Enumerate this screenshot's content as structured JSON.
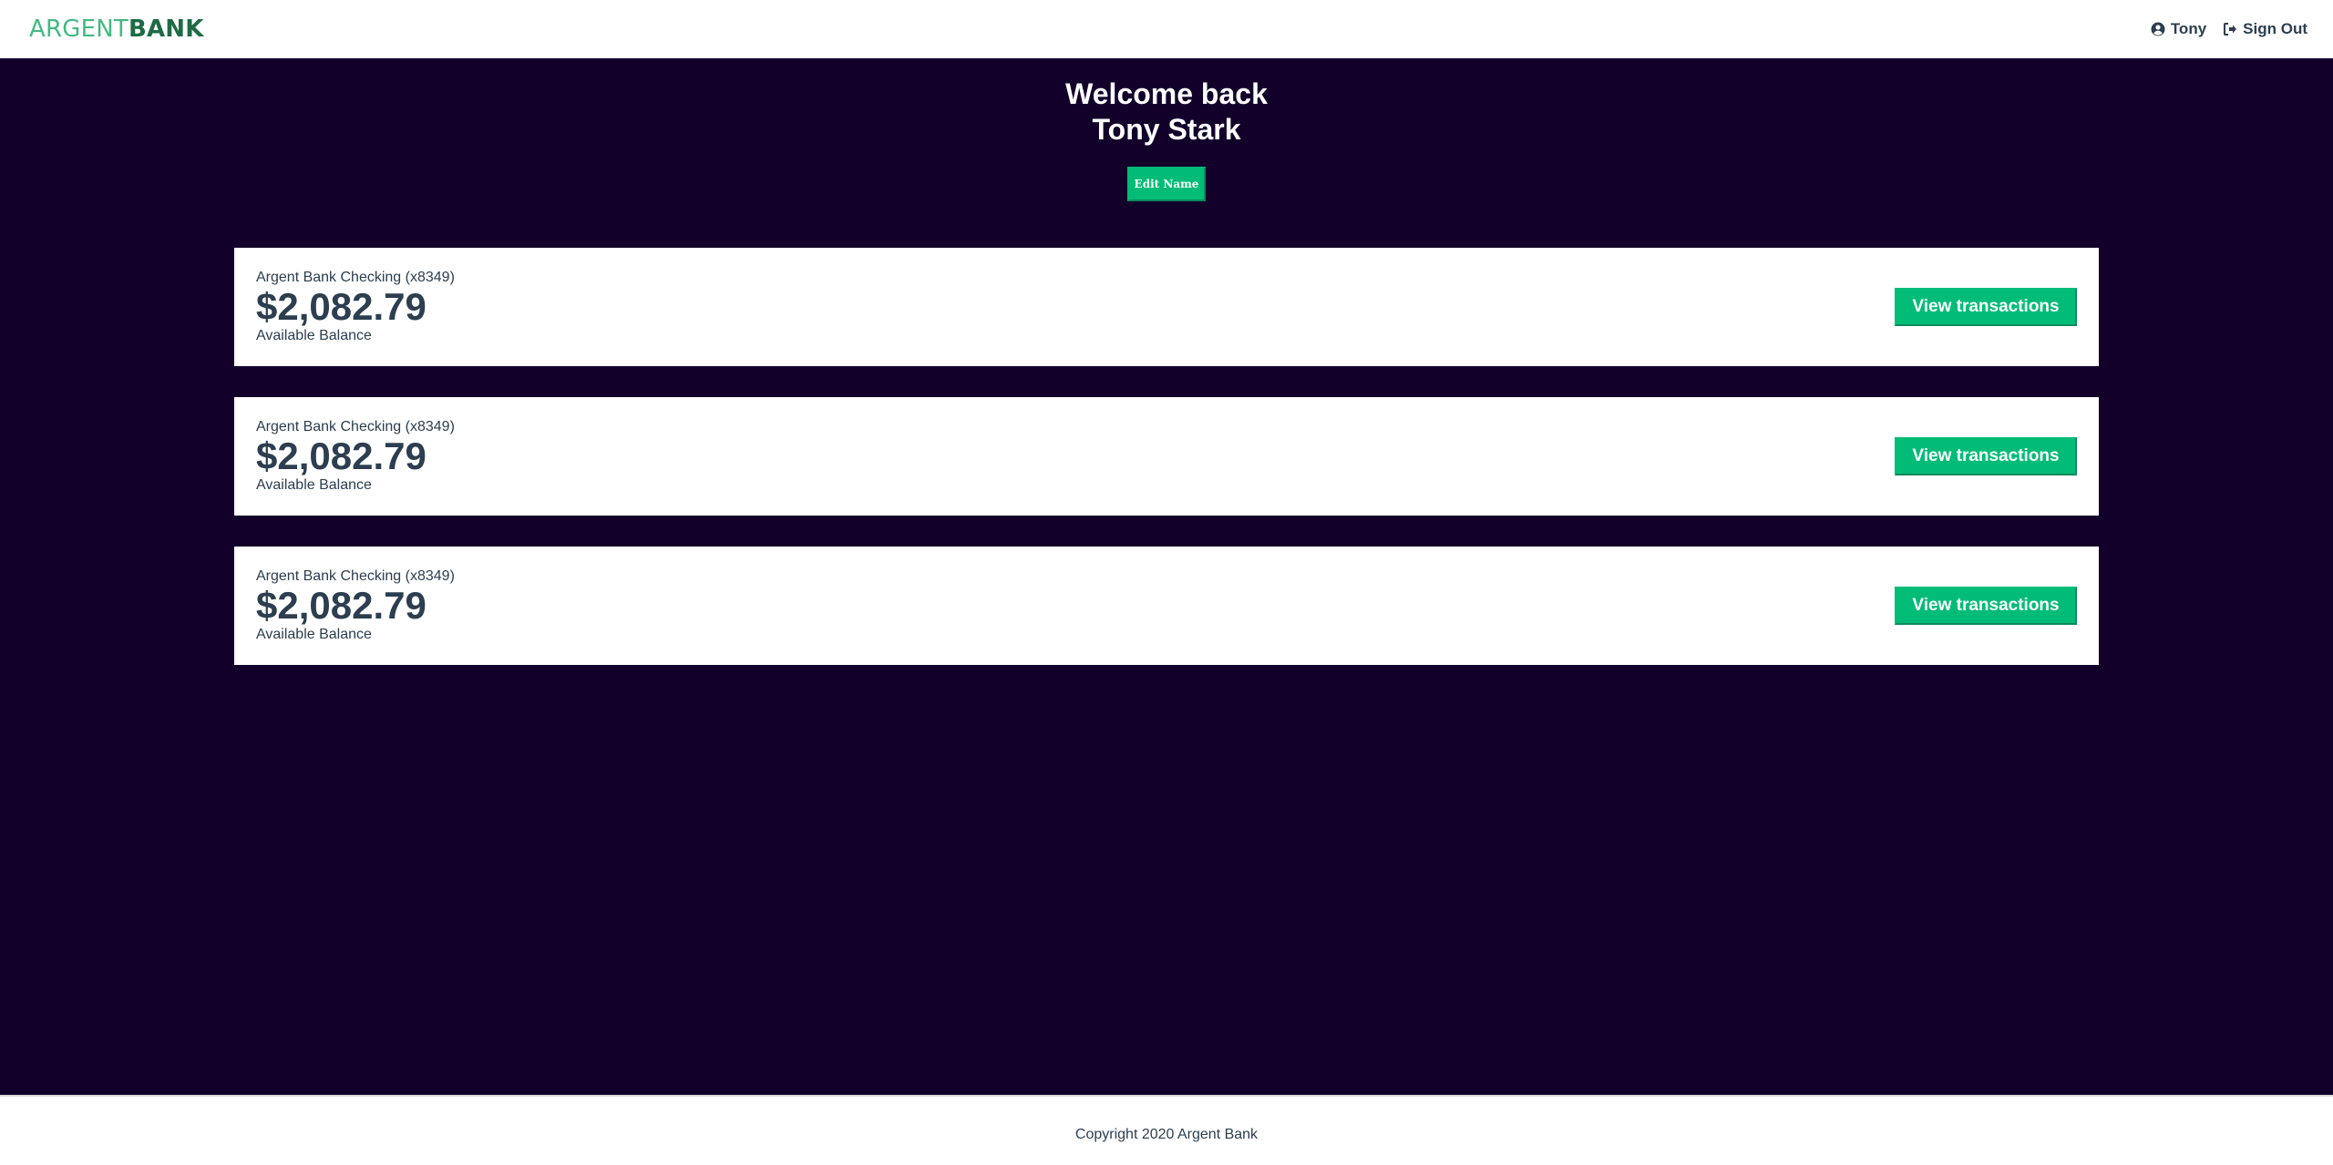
{
  "nav": {
    "logo_part1": "ARGENT",
    "logo_part2": "BANK",
    "user_label": "Tony",
    "user_icon": "user-circle-icon",
    "signout_label": "Sign Out",
    "signout_icon": "sign-out-icon"
  },
  "header": {
    "welcome_line1": "Welcome back",
    "welcome_line2": "Tony Stark",
    "edit_label": "Edit Name"
  },
  "accounts": [
    {
      "title": "Argent Bank Checking (x8349)",
      "amount": "$2,082.79",
      "description": "Available Balance",
      "button_label": "View transactions"
    },
    {
      "title": "Argent Bank Checking (x8349)",
      "amount": "$2,082.79",
      "description": "Available Balance",
      "button_label": "View transactions"
    },
    {
      "title": "Argent Bank Checking (x8349)",
      "amount": "$2,082.79",
      "description": "Available Balance",
      "button_label": "View transactions"
    }
  ],
  "footer": {
    "text": "Copyright 2020 Argent Bank"
  },
  "colors": {
    "accent": "#00bc77",
    "background": "#12002b",
    "logo_light": "#42b983",
    "logo_dark": "#1e6b45",
    "text": "#2c3e50"
  }
}
